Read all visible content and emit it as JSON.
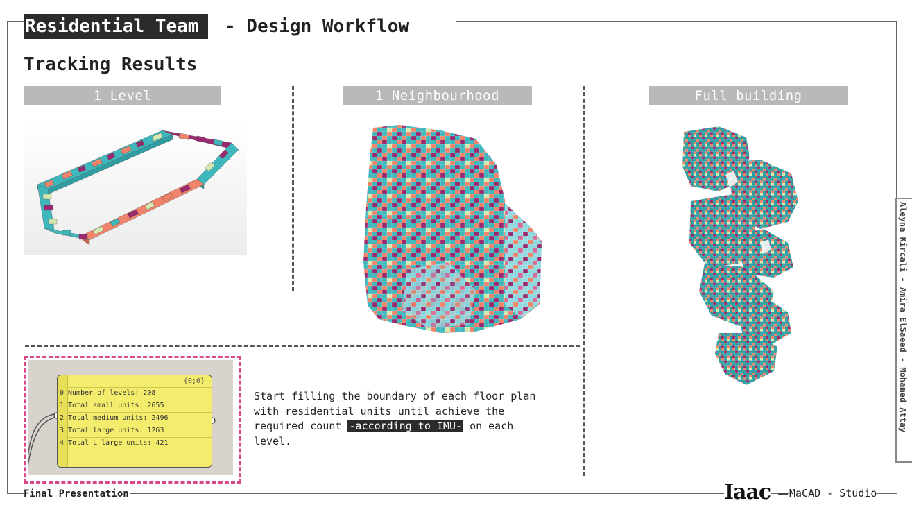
{
  "header": {
    "team": "Residential Team",
    "workflow": "- Design Workflow",
    "subtitle": "Tracking Results"
  },
  "sections": [
    {
      "label": "1 Level"
    },
    {
      "label": "1 Neighbourhood"
    },
    {
      "label": "Full building"
    }
  ],
  "panel": {
    "header": "{0;0}",
    "rows": [
      {
        "index": "0",
        "text": "Number of levels: 208"
      },
      {
        "index": "1",
        "text": "Total small units: 2655"
      },
      {
        "index": "2",
        "text": "Total medium units: 2496"
      },
      {
        "index": "3",
        "text": "Total large units: 1263"
      },
      {
        "index": "4",
        "text": "Total L large units: 421"
      }
    ]
  },
  "description": {
    "before": "Start filling the boundary of each floor plan with residential units until achieve the required count",
    "highlight": "-according to IMU-",
    "after": "on each level."
  },
  "credits": "Aleyna Kircali - Amira ElSaeed - Mohamed Attay",
  "footer": {
    "left": "Final Presentation",
    "logo": "Iaac",
    "right": "MaCAD - Studio"
  },
  "colors": {
    "teal": "#3fb8bd",
    "salmon": "#f0846a",
    "magenta": "#9a2a6e",
    "pale_green": "#d6e8b0",
    "tag_gray": "#b9b9b9",
    "dark": "#2b2b2b",
    "pink_border": "#d9478a"
  }
}
